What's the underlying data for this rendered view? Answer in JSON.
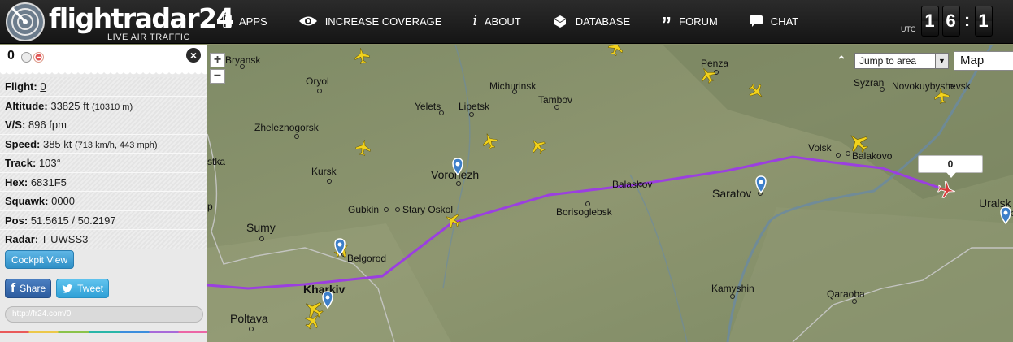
{
  "header": {
    "logo_text": "flightradar24",
    "logo_tagline": "LIVE AIR TRAFFIC",
    "nav": [
      {
        "label": "APPS",
        "icon": "phone-icon"
      },
      {
        "label": "INCREASE COVERAGE",
        "icon": "eye-icon"
      },
      {
        "label": "ABOUT",
        "icon": "info-icon"
      },
      {
        "label": "DATABASE",
        "icon": "database-icon"
      },
      {
        "label": "FORUM",
        "icon": "quote-icon"
      },
      {
        "label": "CHAT",
        "icon": "chat-bubble-icon"
      }
    ],
    "clock": {
      "zone": "UTC",
      "digits": [
        "1",
        "6",
        ":",
        "1"
      ]
    }
  },
  "panel": {
    "flight_title": "0",
    "rows": [
      {
        "label": "Flight:",
        "value": "0",
        "extra": ""
      },
      {
        "label": "Altitude:",
        "value": "33825 ft",
        "extra": "(10310 m)"
      },
      {
        "label": "V/S:",
        "value": "896 fpm",
        "extra": ""
      },
      {
        "label": "Speed:",
        "value": "385 kt",
        "extra": "(713 km/h, 443 mph)"
      },
      {
        "label": "Track:",
        "value": "103°",
        "extra": ""
      },
      {
        "label": "Hex:",
        "value": "6831F5",
        "extra": ""
      },
      {
        "label": "Squawk:",
        "value": "0000",
        "extra": ""
      },
      {
        "label": "Pos:",
        "value": "51.5615 / 50.2197",
        "extra": ""
      },
      {
        "label": "Radar:",
        "value": "T-UWSS3",
        "extra": ""
      }
    ],
    "cockpit_button": "Cockpit View",
    "share_button": "Share",
    "tweet_button": "Tweet",
    "link_field": "http://fr24.com/0"
  },
  "map": {
    "zoom_in": "+",
    "zoom_out": "−",
    "jump_select": "Jump to area",
    "map_type": "Map",
    "selected_flight_tag": "0",
    "cities": [
      "Bryansk",
      "Oryol",
      "Michurinsk",
      "Tambov",
      "Penza",
      "Syzran",
      "Novokuybyshevsk",
      "Yelets",
      "Lipetsk",
      "Zheleznogorsk",
      "Kursk",
      "Voronezh",
      "Volsk",
      "Balakovo",
      "Balashov",
      "Saratov",
      "Gubkin",
      "Stary Oskol",
      "Borisoglebsk",
      "Sumy",
      "Belgorod",
      "Kharkiv",
      "Kamyshin",
      "Qaraoba",
      "Poltava",
      "Uralsk",
      "stka",
      "p"
    ],
    "colors": {
      "route": "#9b3fe0",
      "aircraft": "#f2d21c",
      "selected_aircraft": "#d63a3a"
    }
  }
}
